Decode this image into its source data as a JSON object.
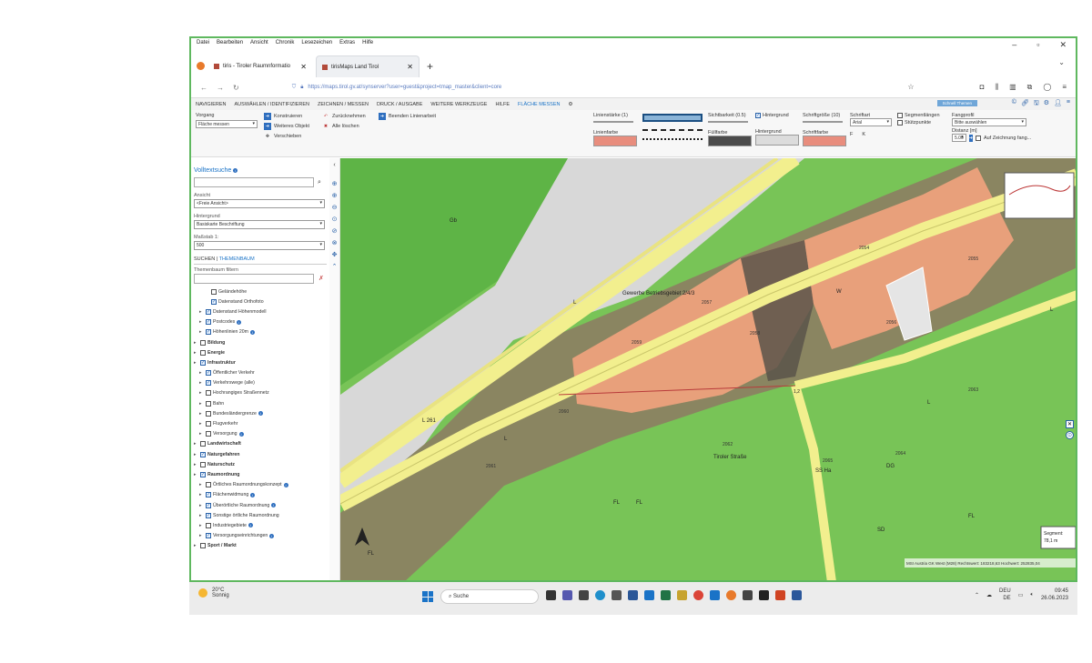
{
  "menu": [
    "Datei",
    "Bearbeiten",
    "Ansicht",
    "Chronik",
    "Lesezeichen",
    "Extras",
    "Hilfe"
  ],
  "tabs": [
    {
      "label": "tiris - Tiroler Raumnformatio",
      "active": false
    },
    {
      "label": "tirisMaps Land Tirol",
      "active": true
    }
  ],
  "url": "https://maps.tirol.gv.at/synserver?user=guest&project=tmap_master&client=core",
  "appnav": {
    "items": [
      "NAVIGIEREN",
      "AUSWÄHLEN / IDENTIFIZIEREN",
      "ZEICHNEN / MESSEN",
      "DRUCK / AUSGABE",
      "WEITERE WERKZEUGE",
      "HILFE",
      "FLÄCHE MESSEN"
    ],
    "active_index": 6,
    "theme_button": "Schnell Themen"
  },
  "ribbon": {
    "mode_label": "Vorgang",
    "mode_value": "Fläche messen",
    "buttons": [
      "Konstruieren",
      "Weiteres Objekt",
      "Verschieben",
      "Zurücknehmen",
      "Alle löschen",
      "Beenden Linienarbeit"
    ],
    "line_width": "Linienstärke (1)",
    "line_color": "Linienfarbe",
    "visibility": "Sichtbarkeit (0.5)",
    "fill_color": "Füllfarbe",
    "background_check": "Hintergrund",
    "background_color": "Hintergrund",
    "font_size": "Schriftgröße (10)",
    "font_color": "Schriftfarbe",
    "font_label": "Schriftart",
    "font_value": "Arial",
    "format_f": "F",
    "format_k": "K",
    "segment_lengths": "Segmentlängen",
    "support_points": "Stützpunkte",
    "snap_label": "Fangprofil",
    "snap_value": "Bitte auswählen",
    "distance_label": "Distanz [m]",
    "distance_value": "5.00",
    "draw_option": "Auf Zeichnung fang..."
  },
  "sidebar": {
    "search_title": "Volltextsuche",
    "view_label": "Ansicht",
    "view_value": "<Freie Ansicht>",
    "bg_label": "Hintergrund",
    "bg_value": "Basiskarte Beschriftung",
    "scale_label": "Maßstab 1:",
    "scale_value": "500",
    "tab_search": "SUCHEN",
    "tab_themes": "THEMENBAUM",
    "filter_label": "Themenbaum filtern",
    "layers": [
      {
        "label": "Geländehöhe",
        "indent": 2,
        "checked": false,
        "arrow": false,
        "bold": false,
        "info": false
      },
      {
        "label": "Datenstand Orthofoto",
        "indent": 2,
        "checked": true,
        "arrow": false,
        "bold": false,
        "info": false
      },
      {
        "label": "Datenstand Höhenmodell",
        "indent": 1,
        "checked": true,
        "arrow": true,
        "bold": false,
        "info": false
      },
      {
        "label": "Postcodes",
        "indent": 1,
        "checked": true,
        "arrow": true,
        "bold": false,
        "info": true
      },
      {
        "label": "Höhenlinien 20m",
        "indent": 1,
        "checked": true,
        "arrow": true,
        "bold": false,
        "info": true
      },
      {
        "label": "Bildung",
        "indent": 0,
        "checked": false,
        "arrow": true,
        "bold": true,
        "info": false
      },
      {
        "label": "Energie",
        "indent": 0,
        "checked": false,
        "arrow": true,
        "bold": true,
        "info": false
      },
      {
        "label": "Infrastruktur",
        "indent": 0,
        "checked": true,
        "arrow": true,
        "bold": true,
        "info": false
      },
      {
        "label": "Öffentlicher Verkehr",
        "indent": 1,
        "checked": true,
        "arrow": true,
        "bold": false,
        "info": false
      },
      {
        "label": "Verkehrswege (alle)",
        "indent": 1,
        "checked": true,
        "arrow": true,
        "bold": false,
        "info": false
      },
      {
        "label": "Hochrangiges Straßennetz",
        "indent": 1,
        "checked": false,
        "arrow": true,
        "bold": false,
        "info": false
      },
      {
        "label": "Bahn",
        "indent": 1,
        "checked": false,
        "arrow": true,
        "bold": false,
        "info": false
      },
      {
        "label": "Bundesländergrenze",
        "indent": 1,
        "checked": false,
        "arrow": true,
        "bold": false,
        "info": true
      },
      {
        "label": "Flugverkehr",
        "indent": 1,
        "checked": false,
        "arrow": true,
        "bold": false,
        "info": false
      },
      {
        "label": "Versorgung",
        "indent": 1,
        "checked": false,
        "arrow": true,
        "bold": false,
        "info": true
      },
      {
        "label": "Landwirtschaft",
        "indent": 0,
        "checked": false,
        "arrow": true,
        "bold": true,
        "info": false
      },
      {
        "label": "Naturgefahren",
        "indent": 0,
        "checked": true,
        "arrow": true,
        "bold": true,
        "info": false
      },
      {
        "label": "Naturschutz",
        "indent": 0,
        "checked": false,
        "arrow": true,
        "bold": true,
        "info": false
      },
      {
        "label": "Raumordnung",
        "indent": 0,
        "checked": true,
        "arrow": true,
        "bold": true,
        "info": false
      },
      {
        "label": "Örtliches Raumordnungskonzept",
        "indent": 1,
        "checked": false,
        "arrow": true,
        "bold": false,
        "info": true
      },
      {
        "label": "Flächenwidmung",
        "indent": 1,
        "checked": true,
        "arrow": true,
        "bold": false,
        "info": true
      },
      {
        "label": "Überörtliche Raumordnung",
        "indent": 1,
        "checked": true,
        "arrow": true,
        "bold": false,
        "info": true
      },
      {
        "label": "Sonstige örtliche Raumordnung",
        "indent": 1,
        "checked": true,
        "arrow": true,
        "bold": false,
        "info": false
      },
      {
        "label": "Industriegebiete",
        "indent": 1,
        "checked": false,
        "arrow": true,
        "bold": false,
        "info": true
      },
      {
        "label": "Versorgungseinrichtungen",
        "indent": 1,
        "checked": true,
        "arrow": true,
        "bold": false,
        "info": true
      },
      {
        "label": "Sport / Markt",
        "indent": 0,
        "checked": false,
        "arrow": true,
        "bold": true,
        "info": false
      }
    ]
  },
  "map": {
    "labels": {
      "church": "Gewerbe Betriebsgebiet 2/4/3",
      "road_a": "L",
      "center_w": "W",
      "segment_title": "Segment:",
      "segment_value": "78,1 m",
      "copyright": "MSI Austria GK West (M28) Rechtswert: 183218,63 Hochwert: 252835,04",
      "road_label": "L 261",
      "gb1": "Gb",
      "fl1": "FL",
      "fl2": "FL",
      "fl3": "FL",
      "fl4": "FL",
      "ss": "SS Ha",
      "l2": "L",
      "l3": "L",
      "l4": "L",
      "tiroler": "Tiroler Straße",
      "dg": "DG",
      "sd": "SD"
    },
    "parcels": [
      "2054",
      "2055",
      "2056",
      "2057",
      "2058",
      "2059",
      "2060",
      "2061",
      "2062",
      "2063",
      "2064",
      "2065",
      "2066",
      "2067",
      "2068",
      "2069",
      "2070"
    ],
    "measure_point": "1,2"
  },
  "taskbar": {
    "temp": "20°C",
    "weather": "Sonnig",
    "search": "Suche",
    "lang1": "DEU",
    "lang2": "DE",
    "time": "09:45",
    "date": "26.06.2023"
  },
  "colors": {
    "accent": "#1a73c7",
    "map_green": "#6cc34f",
    "parcel_orange": "#e8a07b",
    "road_yellow": "#f2ef8e",
    "brown_zone": "#8b8461"
  }
}
